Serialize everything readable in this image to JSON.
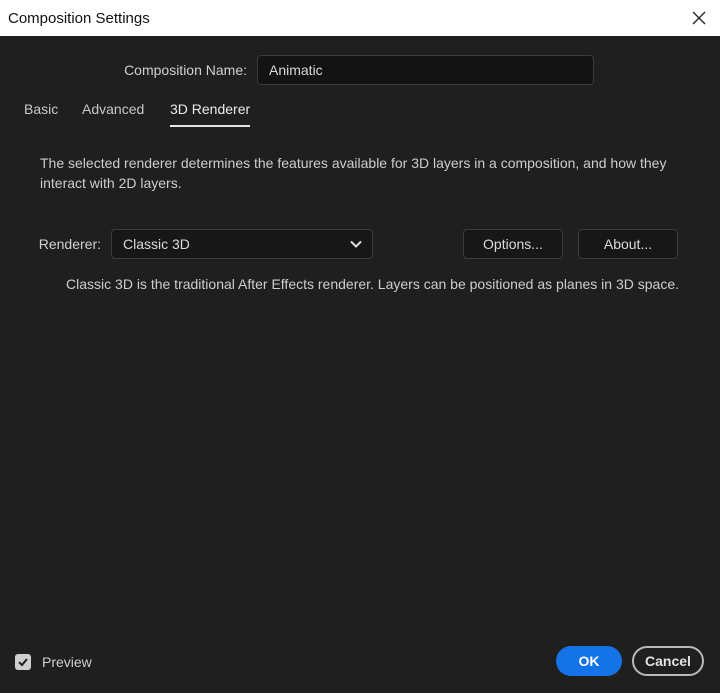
{
  "window": {
    "title": "Composition Settings",
    "close_icon": "close-icon"
  },
  "composition_name": {
    "label": "Composition Name:",
    "value": "Animatic"
  },
  "tabs": [
    {
      "label": "Basic",
      "active": false
    },
    {
      "label": "Advanced",
      "active": false
    },
    {
      "label": "3D Renderer",
      "active": true
    }
  ],
  "description": "The selected renderer determines the features available for 3D layers in a composition, and how they interact with 2D layers.",
  "renderer": {
    "label": "Renderer:",
    "selected": "Classic 3D",
    "options_button": "Options...",
    "about_button": "About...",
    "info": "Classic 3D is the traditional After Effects renderer. Layers can be positioned as planes in 3D space."
  },
  "footer": {
    "preview_label": "Preview",
    "preview_checked": true,
    "ok_label": "OK",
    "cancel_label": "Cancel"
  },
  "colors": {
    "background": "#1f1f1f",
    "accent": "#1473e6",
    "titlebar": "#ffffff"
  }
}
